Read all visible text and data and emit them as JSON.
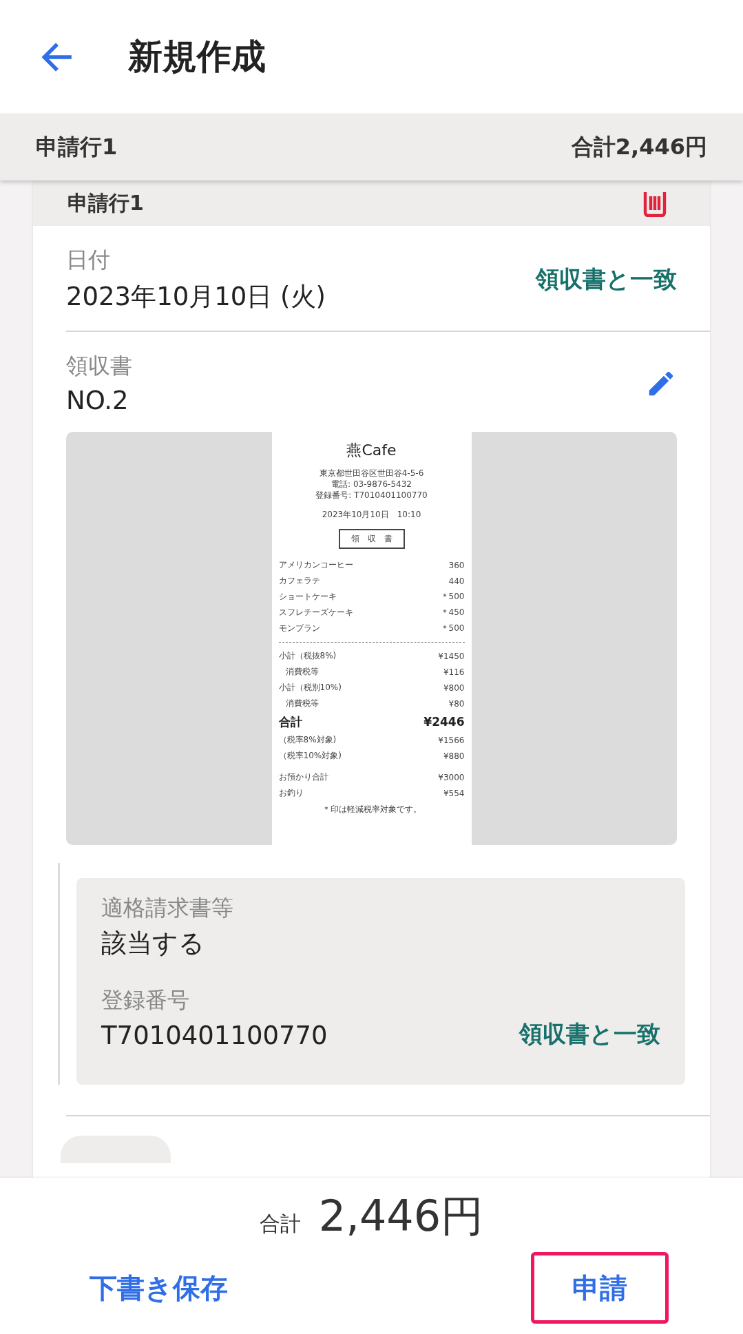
{
  "app_bar": {
    "title": "新規作成"
  },
  "sticky_header": {
    "label": "申請行1",
    "total": "合計2,446円"
  },
  "line_card": {
    "title": "申請行1",
    "date": {
      "label": "日付",
      "value": "2023年10月10日 (火)",
      "match": "領収書と一致"
    },
    "receipt": {
      "label": "領収書",
      "value": "NO.2",
      "image": {
        "store": "燕Cafe",
        "address": "東京都世田谷区世田谷4-5-6",
        "phone": "電話: 03-9876-5432",
        "registration": "登録番号: T7010401100770",
        "datetime": "2023年10月10日　10:10",
        "doc_title": "領　収　書",
        "items": [
          {
            "name": "アメリカンコーヒー",
            "price": "360"
          },
          {
            "name": "カフェラテ",
            "price": "440"
          },
          {
            "name": "ショートケーキ",
            "price": "＊500"
          },
          {
            "name": "スフレチーズケーキ",
            "price": "＊450"
          },
          {
            "name": "モンブラン",
            "price": "＊500"
          }
        ],
        "summary": [
          {
            "kind": "line",
            "name": "小計（税抜8%)",
            "price": "¥1450"
          },
          {
            "kind": "indent",
            "name": "消費税等",
            "price": "¥116"
          },
          {
            "kind": "line",
            "name": "小計（税別10%)",
            "price": "¥800"
          },
          {
            "kind": "indent",
            "name": "消費税等",
            "price": "¥80"
          },
          {
            "kind": "total",
            "name": "合計",
            "price": "¥2446"
          },
          {
            "kind": "line",
            "name": "（税率8%対象)",
            "price": "¥1566"
          },
          {
            "kind": "line",
            "name": "（税率10%対象)",
            "price": "¥880"
          },
          {
            "kind": "gap",
            "name": "お預かり合計",
            "price": "¥3000"
          },
          {
            "kind": "line",
            "name": "お釣り",
            "price": "¥554"
          }
        ],
        "note": "＊印は軽減税率対象です。"
      }
    },
    "invoice": {
      "label": "適格請求書等",
      "value": "該当する",
      "reg_label": "登録番号",
      "reg_value": "T7010401100770",
      "match": "領収書と一致"
    }
  },
  "footer": {
    "total_label": "合計",
    "total": "2,446円",
    "draft_button": "下書き保存",
    "submit_button": "申請"
  }
}
